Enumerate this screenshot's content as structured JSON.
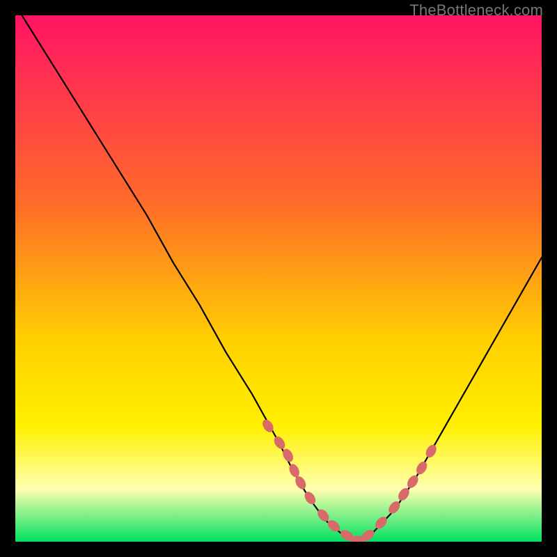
{
  "watermark": "TheBottleneck.com",
  "colors": {
    "bg_black": "#000000",
    "curve_stroke": "#000000",
    "dot_fill": "#d86a6a",
    "grad_top": "#ff1464",
    "grad_mid1": "#ff6a2a",
    "grad_mid2": "#ffd000",
    "grad_mid3": "#fff000",
    "grad_pale": "#ffffb0",
    "grad_green": "#00e060"
  },
  "chart_data": {
    "type": "line",
    "title": "",
    "xlabel": "",
    "ylabel": "",
    "xlim": [
      0,
      100
    ],
    "ylim": [
      0,
      100
    ],
    "series": [
      {
        "name": "bottleneck-curve",
        "x": [
          0,
          5,
          10,
          15,
          20,
          25,
          30,
          35,
          40,
          45,
          50,
          53,
          56,
          59,
          62,
          65,
          68,
          72,
          76,
          80,
          84,
          88,
          92,
          96,
          100
        ],
        "y": [
          102,
          94,
          86,
          78,
          70,
          62,
          53,
          45,
          36,
          28,
          19,
          13,
          8,
          4,
          1.5,
          0.3,
          1.8,
          6,
          12,
          19,
          26,
          33,
          40,
          47,
          54
        ]
      }
    ],
    "highlight_points": {
      "name": "optimal-range-dots",
      "x": [
        48,
        50.2,
        51.8,
        53,
        54.2,
        56,
        58.5,
        60.5,
        63,
        65,
        67,
        69.5,
        72,
        73.8,
        75.5,
        77.2,
        79
      ],
      "y": [
        22,
        18.8,
        16.4,
        13.5,
        11.2,
        8.3,
        5.0,
        3.0,
        1.2,
        0.3,
        1.2,
        3.6,
        6.5,
        9.0,
        11.4,
        14.0,
        17.2
      ]
    },
    "gradient_stops": [
      {
        "pct": 0,
        "key": "grad_top"
      },
      {
        "pct": 35,
        "key": "grad_mid1"
      },
      {
        "pct": 62,
        "key": "grad_mid2"
      },
      {
        "pct": 78,
        "key": "grad_mid3"
      },
      {
        "pct": 90,
        "key": "grad_pale"
      },
      {
        "pct": 100,
        "key": "grad_green"
      }
    ]
  }
}
